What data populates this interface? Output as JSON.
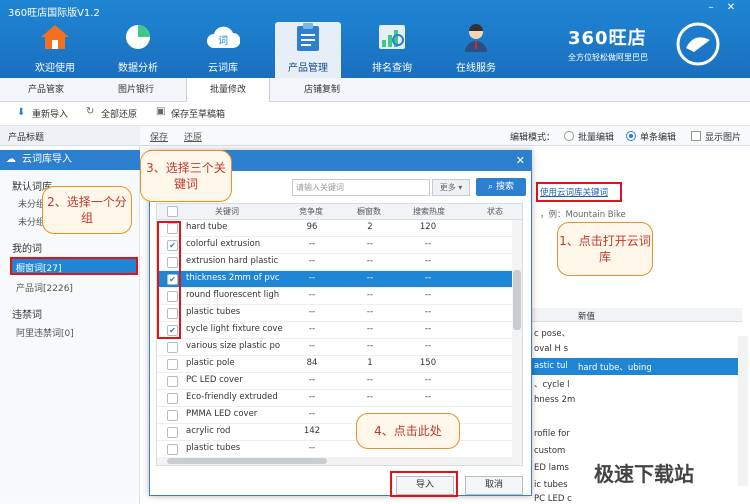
{
  "app": {
    "title": "360旺店国际版V1.2",
    "brand_name": "360旺店",
    "brand_slogan": "全方位轻松做阿里巴巴"
  },
  "toolbar": [
    {
      "label": "欢迎使用",
      "icon": "home-icon"
    },
    {
      "label": "数据分析",
      "icon": "pie-chart-icon"
    },
    {
      "label": "云词库",
      "icon": "cloud-icon"
    },
    {
      "label": "产品管理",
      "icon": "clipboard-icon"
    },
    {
      "label": "排名查询",
      "icon": "ranking-icon"
    },
    {
      "label": "在线服务",
      "icon": "support-person-icon"
    }
  ],
  "subtabs": [
    "产品管家",
    "图片银行",
    "批量修改",
    "店铺复制"
  ],
  "toolbar2": {
    "reimport": "重新导入",
    "restore_all": "全部还原",
    "save_draft": "保存至草稿箱"
  },
  "left": {
    "header": "产品标题"
  },
  "editbar": {
    "save": "保存",
    "restore": "还原",
    "mode_label": "编辑模式：",
    "batch": "批量编辑",
    "single": "单条编辑",
    "show_images": "显示图片"
  },
  "dialog": {
    "title": "云词库导入",
    "side": {
      "default_lib": "默认词库",
      "unsorted1": "未分组",
      "unsorted2": "未分组",
      "my_words": "我的词",
      "group_selected": "橱窗词[27]",
      "product_words": "产品词[2226]",
      "banned": "违禁词",
      "ali_banned": "阿里违禁词[0]"
    },
    "search_placeholder": "请输入关键词",
    "more": "更多",
    "search_btn": "搜索",
    "columns": [
      "关键词",
      "竞争度",
      "橱窗数",
      "搜索热度",
      "状态"
    ],
    "rows": [
      {
        "kw": "hard tube",
        "comp": "96",
        "win": "2",
        "heat": "120",
        "checked": false
      },
      {
        "kw": "colorful extrusion",
        "comp": "--",
        "win": "--",
        "heat": "--",
        "checked": true
      },
      {
        "kw": "extrusion hard plastic",
        "comp": "--",
        "win": "--",
        "heat": "--",
        "checked": false
      },
      {
        "kw": "thickness 2mm of pvc",
        "comp": "--",
        "win": "--",
        "heat": "--",
        "checked": true
      },
      {
        "kw": "round fluorescent ligh",
        "comp": "--",
        "win": "--",
        "heat": "--",
        "checked": false
      },
      {
        "kw": "plastic tubes",
        "comp": "--",
        "win": "--",
        "heat": "--",
        "checked": false
      },
      {
        "kw": "cycle light fixture cove",
        "comp": "--",
        "win": "--",
        "heat": "--",
        "checked": true
      },
      {
        "kw": "various size plastic po",
        "comp": "--",
        "win": "--",
        "heat": "--",
        "checked": false
      },
      {
        "kw": "plastic pole",
        "comp": "84",
        "win": "1",
        "heat": "150",
        "checked": false
      },
      {
        "kw": "PC LED cover",
        "comp": "--",
        "win": "--",
        "heat": "--",
        "checked": false
      },
      {
        "kw": "Eco-friendly extruded",
        "comp": "--",
        "win": "--",
        "heat": "--",
        "checked": false
      },
      {
        "kw": "PMMA LED cover",
        "comp": "--",
        "win": "--",
        "heat": "--",
        "checked": false
      },
      {
        "kw": "acrylic rod",
        "comp": "142",
        "win": "--",
        "heat": "--",
        "checked": false
      },
      {
        "kw": "plastic  tubes",
        "comp": "--",
        "win": "--",
        "heat": "--",
        "checked": false
      }
    ],
    "import_btn": "导入",
    "cancel_btn": "取消"
  },
  "right": {
    "use_cloud_link": "使用云词库关键词",
    "example": "，例：Mountain Bike",
    "new_value_header": "新值",
    "new_value": "hard tube、ubing",
    "frag": [
      "c pose、",
      "oval H  s",
      "astic tul",
      "、cycle l",
      "hness 2m",
      "rofile for",
      "custom",
      "ED lams",
      "ic tubes",
      "PC LED c"
    ]
  },
  "callouts": {
    "c1": "1、点击打开云词库",
    "c2": "2、选择一个分组",
    "c3": "3、选择三个关键词",
    "c4": "4、点击此处"
  },
  "watermark": "极速下载站",
  "colors": {
    "topbar": "#1f86d4",
    "selected_row": "#1e86d4",
    "callout_border": "#e9902e",
    "highlight_box": "#e0131b"
  }
}
